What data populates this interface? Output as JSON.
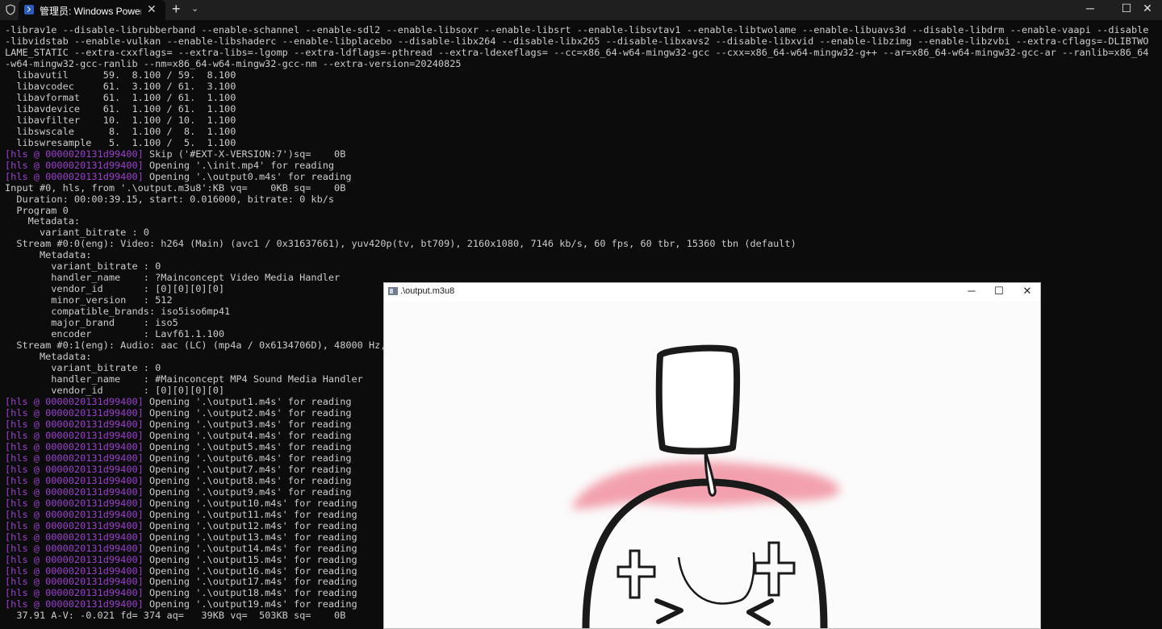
{
  "window": {
    "tab_title": "管理员: Windows PowerShell",
    "tab_close": "✕",
    "new_tab": "+",
    "dropdown": "⌄",
    "minimize": "─",
    "maximize": "☐",
    "close": "✕"
  },
  "terminal": {
    "lines": [
      {
        "text": "-librav1e --disable-librubberband --enable-schannel --enable-sdl2 --enable-libsoxr --enable-libsrt --enable-libsvtav1 --enable-libtwolame --enable-libuavs3d --disable-libdrm --enable-vaapi --disable"
      },
      {
        "text": "-libvidstab --enable-vulkan --enable-libshaderc --enable-libplacebo --disable-libx264 --disable-libx265 --disable-libxavs2 --disable-libxvid --enable-libzimg --enable-libzvbi --extra-cflags=-DLIBTWO"
      },
      {
        "text": "LAME_STATIC --extra-cxxflags= --extra-libs=-lgomp --extra-ldflags=-pthread --extra-ldexeflags= --cc=x86_64-w64-mingw32-gcc --cxx=x86_64-w64-mingw32-g++ --ar=x86_64-w64-mingw32-gcc-ar --ranlib=x86_64"
      },
      {
        "text": "-w64-mingw32-gcc-ranlib --nm=x86_64-w64-mingw32-gcc-nm --extra-version=20240825"
      },
      {
        "text": "  libavutil      59.  8.100 / 59.  8.100"
      },
      {
        "text": "  libavcodec     61.  3.100 / 61.  3.100"
      },
      {
        "text": "  libavformat    61.  1.100 / 61.  1.100"
      },
      {
        "text": "  libavdevice    61.  1.100 / 61.  1.100"
      },
      {
        "text": "  libavfilter    10.  1.100 / 10.  1.100"
      },
      {
        "text": "  libswscale      8.  1.100 /  8.  1.100"
      },
      {
        "text": "  libswresample   5.  1.100 /  5.  1.100"
      },
      {
        "prefix": "[hls @ 0000020131d99400]",
        "text": " Skip ('#EXT-X-VERSION:7')sq=    0B"
      },
      {
        "prefix": "[hls @ 0000020131d99400]",
        "text": " Opening '.\\init.mp4' for reading"
      },
      {
        "prefix": "[hls @ 0000020131d99400]",
        "text": " Opening '.\\output0.m4s' for reading"
      },
      {
        "text": "Input #0, hls, from '.\\output.m3u8':KB vq=    0KB sq=    0B"
      },
      {
        "text": "  Duration: 00:00:39.15, start: 0.016000, bitrate: 0 kb/s"
      },
      {
        "text": "  Program 0"
      },
      {
        "text": "    Metadata:"
      },
      {
        "text": "      variant_bitrate : 0"
      },
      {
        "text": "  Stream #0:0(eng): Video: h264 (Main) (avc1 / 0x31637661), yuv420p(tv, bt709), 2160x1080, 7146 kb/s, 60 fps, 60 tbr, 15360 tbn (default)"
      },
      {
        "text": "      Metadata:"
      },
      {
        "text": "        variant_bitrate : 0"
      },
      {
        "text": "        handler_name    : ?Mainconcept Video Media Handler"
      },
      {
        "text": "        vendor_id       : [0][0][0][0]"
      },
      {
        "text": "        minor_version   : 512"
      },
      {
        "text": "        compatible_brands: iso5iso6mp41"
      },
      {
        "text": "        major_brand     : iso5"
      },
      {
        "text": "        encoder         : Lavf61.1.100"
      },
      {
        "text": "  Stream #0:1(eng): Audio: aac (LC) (mp4a / 0x6134706D), 48000 Hz,"
      },
      {
        "text": "      Metadata:"
      },
      {
        "text": "        variant_bitrate : 0"
      },
      {
        "text": "        handler_name    : #Mainconcept MP4 Sound Media Handler"
      },
      {
        "text": "        vendor_id       : [0][0][0][0]"
      },
      {
        "prefix": "[hls @ 0000020131d99400]",
        "text": " Opening '.\\output1.m4s' for reading"
      },
      {
        "prefix": "[hls @ 0000020131d99400]",
        "text": " Opening '.\\output2.m4s' for reading"
      },
      {
        "prefix": "[hls @ 0000020131d99400]",
        "text": " Opening '.\\output3.m4s' for reading"
      },
      {
        "prefix": "[hls @ 0000020131d99400]",
        "text": " Opening '.\\output4.m4s' for reading"
      },
      {
        "prefix": "[hls @ 0000020131d99400]",
        "text": " Opening '.\\output5.m4s' for reading"
      },
      {
        "prefix": "[hls @ 0000020131d99400]",
        "text": " Opening '.\\output6.m4s' for reading"
      },
      {
        "prefix": "[hls @ 0000020131d99400]",
        "text": " Opening '.\\output7.m4s' for reading"
      },
      {
        "prefix": "[hls @ 0000020131d99400]",
        "text": " Opening '.\\output8.m4s' for reading"
      },
      {
        "prefix": "[hls @ 0000020131d99400]",
        "text": " Opening '.\\output9.m4s' for reading"
      },
      {
        "prefix": "[hls @ 0000020131d99400]",
        "text": " Opening '.\\output10.m4s' for reading"
      },
      {
        "prefix": "[hls @ 0000020131d99400]",
        "text": " Opening '.\\output11.m4s' for reading"
      },
      {
        "prefix": "[hls @ 0000020131d99400]",
        "text": " Opening '.\\output12.m4s' for reading"
      },
      {
        "prefix": "[hls @ 0000020131d99400]",
        "text": " Opening '.\\output13.m4s' for reading"
      },
      {
        "prefix": "[hls @ 0000020131d99400]",
        "text": " Opening '.\\output14.m4s' for reading"
      },
      {
        "prefix": "[hls @ 0000020131d99400]",
        "text": " Opening '.\\output15.m4s' for reading"
      },
      {
        "prefix": "[hls @ 0000020131d99400]",
        "text": " Opening '.\\output16.m4s' for reading"
      },
      {
        "prefix": "[hls @ 0000020131d99400]",
        "text": " Opening '.\\output17.m4s' for reading"
      },
      {
        "prefix": "[hls @ 0000020131d99400]",
        "text": " Opening '.\\output18.m4s' for reading"
      },
      {
        "prefix": "[hls @ 0000020131d99400]",
        "text": " Opening '.\\output19.m4s' for reading"
      },
      {
        "text": "  37.91 A-V: -0.021 fd= 374 aq=   39KB vq=  503KB sq=    0B"
      }
    ]
  },
  "player": {
    "title": ".\\output.m3u8",
    "minimize": "─",
    "maximize": "☐",
    "close": "✕"
  },
  "colors": {
    "terminal_bg": "#0c0c0c",
    "terminal_text": "#cccccc",
    "hls_prefix": "#9b3fcf",
    "blush": "#f08a9a"
  }
}
